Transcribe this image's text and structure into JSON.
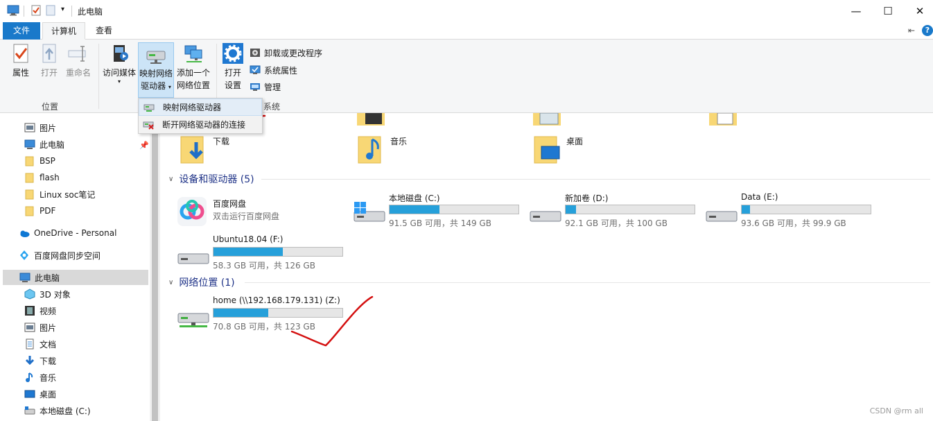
{
  "window": {
    "title": "此电脑",
    "minimize_glyph": "—",
    "maximize_glyph": "☐",
    "close_glyph": "✕"
  },
  "tabs": {
    "file": "文件",
    "computer": "计算机",
    "view": "查看"
  },
  "ribbon": {
    "location": {
      "properties": "属性",
      "open": "打开",
      "rename": "重命名",
      "group_label": "位置"
    },
    "network": {
      "access_media": "访问媒体",
      "map_drive_line1": "映射网络",
      "map_drive_line2": "驱动器",
      "add_location_line1": "添加一个",
      "add_location_line2": "网络位置"
    },
    "system": {
      "open_settings_line1": "打开",
      "open_settings_line2": "设置",
      "uninstall": "卸载或更改程序",
      "system_properties": "系统属性",
      "manage": "管理",
      "group_label": "系统"
    }
  },
  "dropdown": {
    "items": [
      "映射网络驱动器",
      "断开网络驱动器的连接"
    ]
  },
  "nav": {
    "items": [
      {
        "label": "图片"
      },
      {
        "label": "此电脑"
      },
      {
        "label": "BSP"
      },
      {
        "label": "flash"
      },
      {
        "label": "Linux soc笔记"
      },
      {
        "label": "PDF"
      },
      {
        "label": "OneDrive - Personal"
      },
      {
        "label": "百度网盘同步空间"
      },
      {
        "label": "此电脑"
      },
      {
        "label": "3D 对象"
      },
      {
        "label": "视频"
      },
      {
        "label": "图片"
      },
      {
        "label": "文档"
      },
      {
        "label": "下载"
      },
      {
        "label": "音乐"
      },
      {
        "label": "桌面"
      },
      {
        "label": "本地磁盘 (C:)"
      }
    ]
  },
  "folders": {
    "downloads": "下载",
    "music": "音乐",
    "desktop": "桌面"
  },
  "devices": {
    "header": "设备和驱动器 (5)",
    "baidu": {
      "name": "百度网盘",
      "sub": "双击运行百度网盘"
    },
    "drives": [
      {
        "name": "本地磁盘 (C:)",
        "info": "91.5 GB 可用，共 149 GB",
        "used_fraction": 0.386
      },
      {
        "name": "新加卷 (D:)",
        "info": "92.1 GB 可用，共 100 GB",
        "used_fraction": 0.079
      },
      {
        "name": "Data (E:)",
        "info": "93.6 GB 可用，共 99.9 GB",
        "used_fraction": 0.063
      },
      {
        "name": "Ubuntu18.04 (F:)",
        "info": "58.3 GB 可用，共 126 GB",
        "used_fraction": 0.537
      }
    ]
  },
  "network_locations": {
    "header": "网络位置 (1)",
    "drive": {
      "name": "home (\\\\192.168.179.131) (Z:)",
      "info": "70.8 GB 可用，共 123 GB",
      "used_fraction": 0.424
    }
  },
  "watermark": "CSDN @rm all",
  "colors": {
    "accent": "#1979ca",
    "bar": "#26a0da",
    "annotation": "#d40f0f"
  }
}
